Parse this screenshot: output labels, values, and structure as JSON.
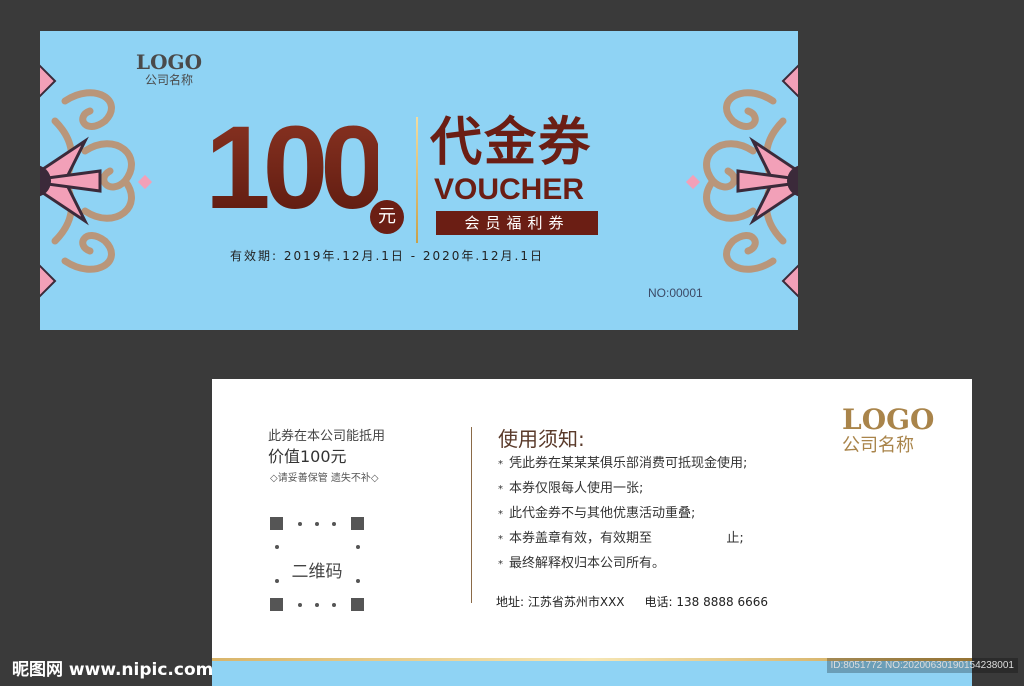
{
  "colors": {
    "background": "#3a3a3a",
    "card_blue": "#8fd3f4",
    "brown": "#6b1e14",
    "gold": "#c8a04a",
    "ornament_tan": "#b9967a",
    "ornament_pink": "#f2a0b8",
    "ornament_dark": "#3b2a3a"
  },
  "front": {
    "logo": "LOGO",
    "company": "公司名称",
    "amount": "100",
    "unit": "元",
    "title_cn": "代金券",
    "title_en": "VOUCHER",
    "member_label": "会员福利券",
    "validity": "有效期: 2019年.12月.1日 - 2020年.12月.1日",
    "serial": "NO:00001"
  },
  "back": {
    "line1": "此券在本公司能抵用",
    "line2": "价值100元",
    "line3": "◇请妥善保管 遗失不补◇",
    "qr_label": "二维码",
    "rules_title": "使用须知:",
    "rules": [
      "凭此券在某某某俱乐部消费可抵现金使用;",
      "本券仅限每人使用一张;",
      "此代金券不与其他优惠活动重叠;",
      "本券盖章有效，有效期至                  止;",
      "最终解释权归本公司所有。"
    ],
    "rule_bullet": "*",
    "address": "地址: 江苏省苏州市XXX",
    "phone": "电话: 138 8888 6666",
    "logo": "LOGO",
    "company": "公司名称"
  },
  "watermark": {
    "left": "昵图网 www.nipic.com",
    "right": "ID:8051772 NO:20200630190154238001"
  },
  "icons": {
    "ornament_left": "floral-ornament-icon",
    "ornament_right": "floral-ornament-icon",
    "qr_placeholder": "qr-code-icon"
  }
}
